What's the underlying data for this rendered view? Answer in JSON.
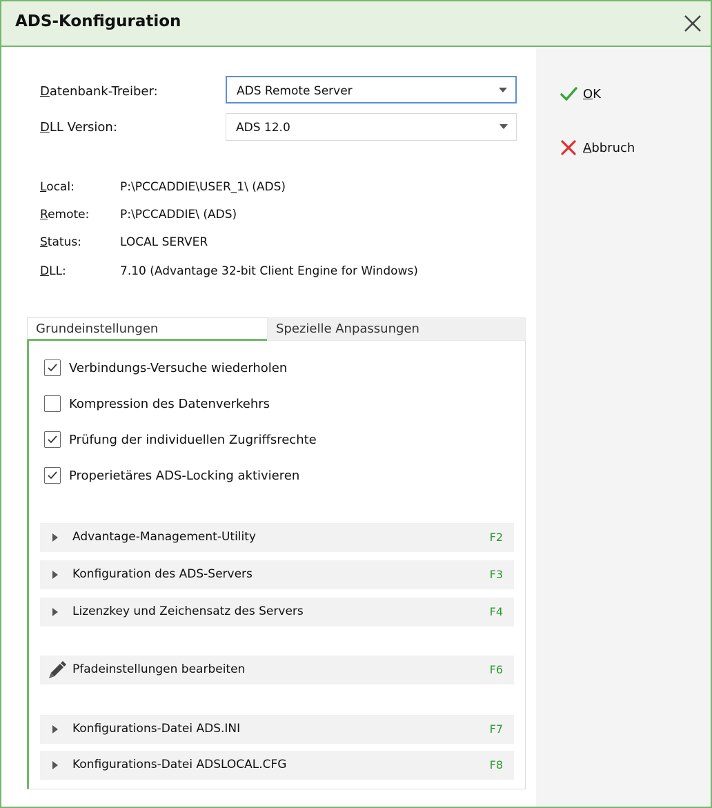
{
  "window": {
    "title": "ADS-Konfiguration"
  },
  "actions": {
    "ok_label": "OK",
    "cancel_label": "Abbruch"
  },
  "settings": {
    "driver_label": "Datenbank-Treiber:",
    "driver_value": "ADS Remote Server",
    "dll_version_label": "DLL Version:",
    "dll_version_value": "ADS 12.0"
  },
  "info": [
    {
      "label": "Local:",
      "value": "P:\\PCCADDIE\\USER_1\\ (ADS)"
    },
    {
      "label": "Remote:",
      "value": "P:\\PCCADDIE\\ (ADS)"
    },
    {
      "label": "Status:",
      "value": "LOCAL SERVER"
    },
    {
      "label": "DLL:",
      "value": "7.10 (Advantage 32-bit Client Engine for Windows)"
    }
  ],
  "tabs": [
    {
      "label": "Grundeinstellungen"
    },
    {
      "label": "Spezielle Anpassungen"
    }
  ],
  "options": [
    {
      "label": "Verbindungs-Versuche wiederholen",
      "checked": true
    },
    {
      "label": "Kompression des Datenverkehrs",
      "checked": false
    },
    {
      "label": "Prüfung der individuellen Zugriffsrechte",
      "checked": true
    },
    {
      "label": "Properietäres ADS-Locking aktivieren",
      "checked": true
    }
  ],
  "items": [
    {
      "label": "Advantage-Management-Utility",
      "key": "F2",
      "icon": "triangle-right-icon"
    },
    {
      "label": "Konfiguration des ADS-Servers",
      "key": "F3",
      "icon": "triangle-right-icon"
    },
    {
      "label": "Lizenzkey und Zeichensatz des Servers",
      "key": "F4",
      "icon": "triangle-right-icon"
    },
    {
      "label": "Pfadeinstellungen bearbeiten",
      "key": "F6",
      "icon": "pencil-icon"
    },
    {
      "label": "Konfigurations-Datei ADS.INI",
      "key": "F7",
      "icon": "triangle-right-icon"
    },
    {
      "label": "Konfigurations-Datei ADSLOCAL.CFG",
      "key": "F8",
      "icon": "triangle-right-icon"
    }
  ],
  "colors": {
    "accent": "#72b86a",
    "shortcut": "#2c9a2c",
    "ok": "#3aa63a",
    "cancel": "#e03030",
    "focus": "#5a8fd8"
  }
}
